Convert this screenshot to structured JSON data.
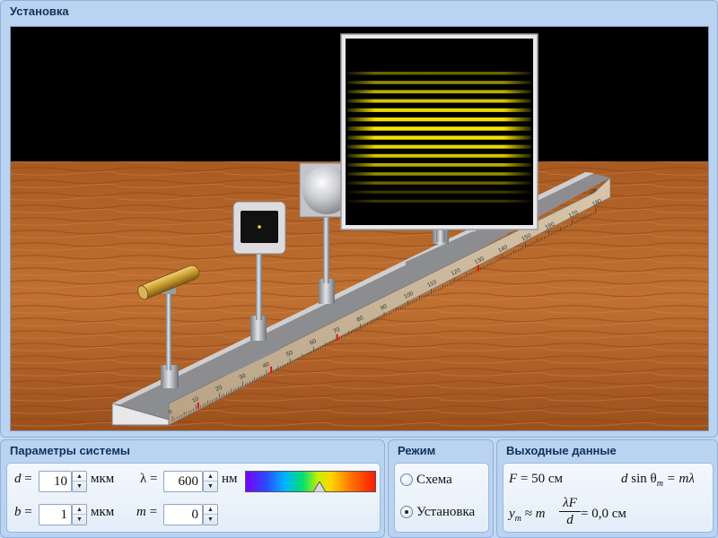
{
  "setup_panel": {
    "title": "Установка"
  },
  "ruler": {
    "ticks": [
      "0",
      "10",
      "20",
      "30",
      "40",
      "50",
      "60",
      "70",
      "80",
      "90",
      "100",
      "110",
      "120",
      "130",
      "140",
      "150",
      "160",
      "170",
      "180"
    ],
    "unit": "см"
  },
  "params_panel": {
    "title": "Параметры системы",
    "d": {
      "symbol": "d",
      "eq": " =",
      "value": "10",
      "unit": "мкм"
    },
    "lambda": {
      "symbol": "λ",
      "eq": " =",
      "value": "600",
      "unit": "нм",
      "slider_fraction": 0.56
    },
    "b": {
      "symbol": "b",
      "eq": " =",
      "value": "1",
      "unit": "мкм"
    },
    "m": {
      "symbol": "m",
      "eq": " =",
      "value": "0"
    }
  },
  "mode_panel": {
    "title": "Режим",
    "options": [
      {
        "label": "Схема",
        "selected": false
      },
      {
        "label": "Установка",
        "selected": true
      }
    ]
  },
  "output_panel": {
    "title": "Выходные данные",
    "F_symbol": "F",
    "F_text": " = 50 см",
    "grating_eq": {
      "d": "d",
      "sin": " sin θ",
      "sub": "m",
      "rhs": " = mλ"
    },
    "ym": {
      "y": "y",
      "sub": "m",
      "approx": " ≈ m",
      "num": "λF",
      "den": "d",
      "result": " = 0,0 см"
    }
  },
  "colors": {
    "accent": "#12305a",
    "fringe": "#f5e600",
    "table_wood": "#b8682c",
    "screen_bg": "#000000"
  }
}
